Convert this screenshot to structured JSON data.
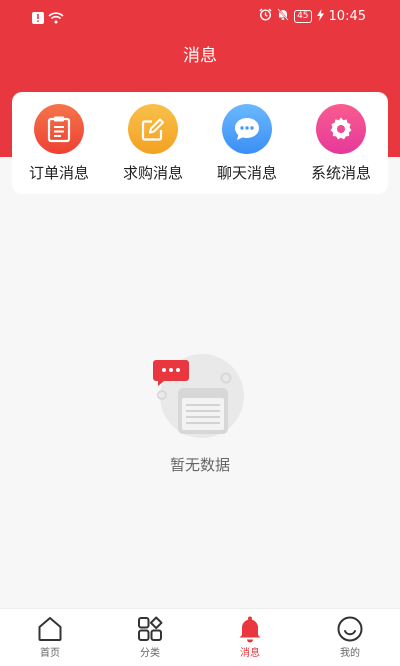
{
  "status_bar": {
    "time": "10:45",
    "battery": "45"
  },
  "header": {
    "title": "消息"
  },
  "categories": [
    {
      "label": "订单消息",
      "icon": "clipboard-icon",
      "color_from": "#f5754a",
      "color_to": "#ee4033"
    },
    {
      "label": "求购消息",
      "icon": "edit-icon",
      "color_from": "#f9c04a",
      "color_to": "#f3a123"
    },
    {
      "label": "聊天消息",
      "icon": "chat-bubble-icon",
      "color_from": "#6bb9ff",
      "color_to": "#3b8ef5"
    },
    {
      "label": "系统消息",
      "icon": "gear-icon",
      "color_from": "#fa5c8f",
      "color_to": "#e5399b"
    }
  ],
  "empty_state": {
    "text": "暂无数据"
  },
  "tabbar": {
    "items": [
      {
        "label": "首页",
        "icon": "home-icon"
      },
      {
        "label": "分类",
        "icon": "category-grid-icon"
      },
      {
        "label": "消息",
        "icon": "bell-icon"
      },
      {
        "label": "我的",
        "icon": "smiley-profile-icon"
      }
    ],
    "active_index": 2
  },
  "colors": {
    "accent": "#e8373e",
    "background": "#f7f7f7"
  }
}
